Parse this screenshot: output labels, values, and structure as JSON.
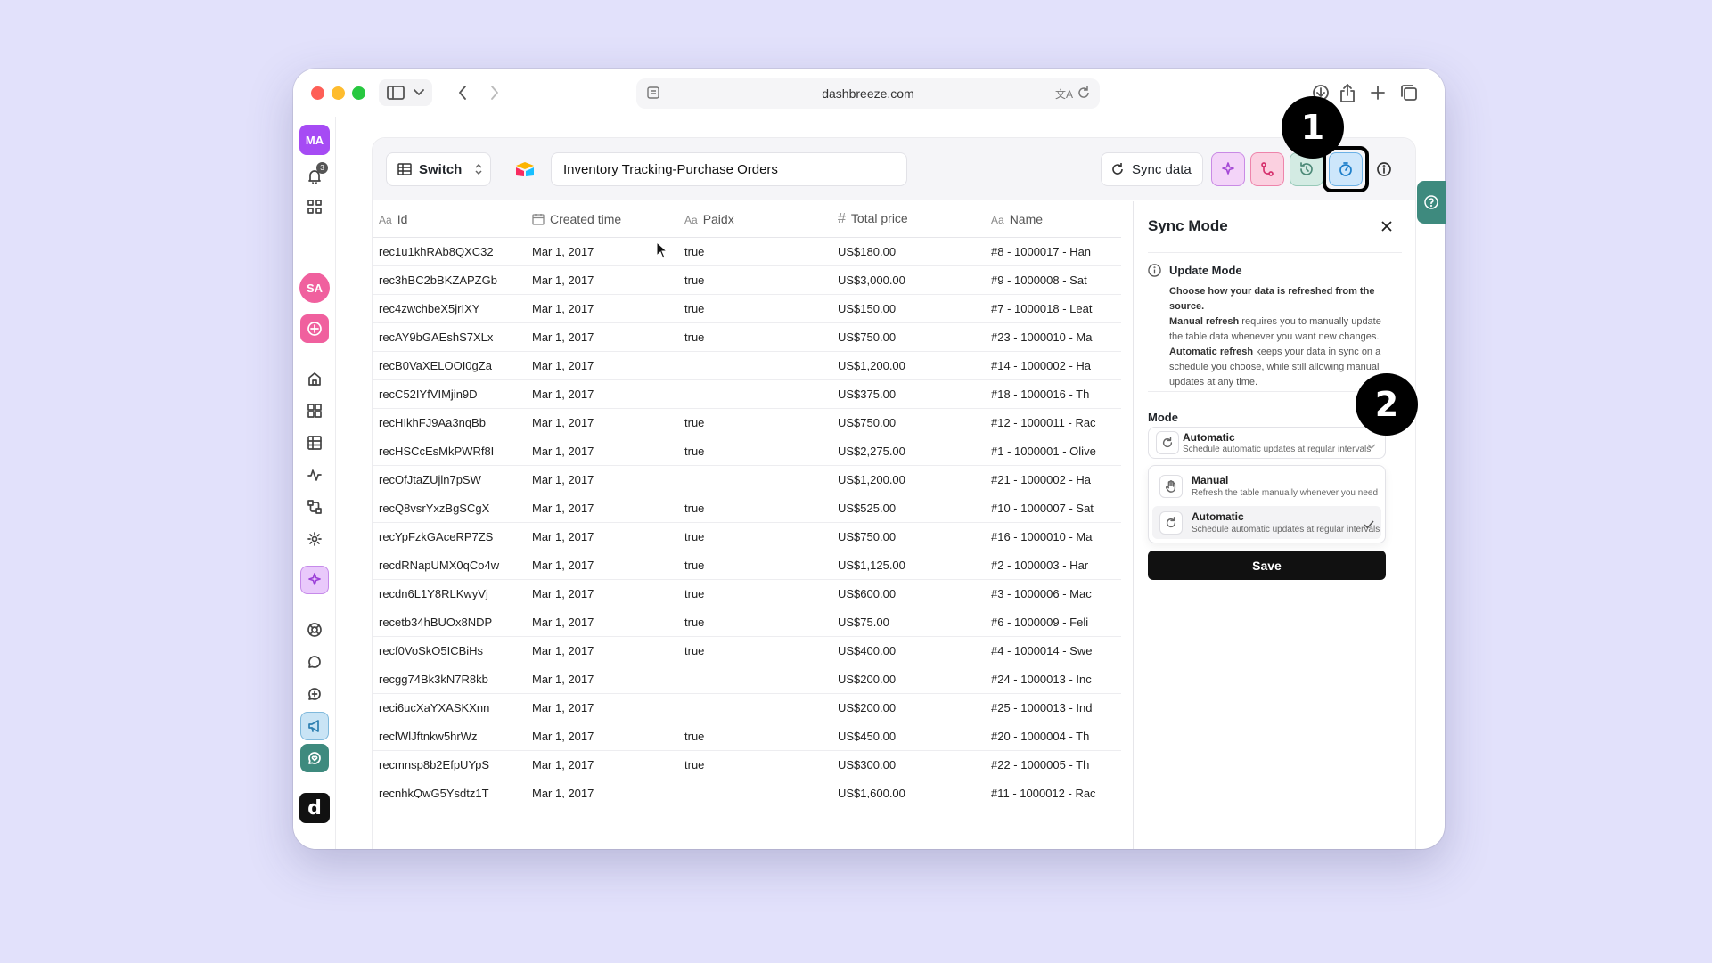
{
  "browser": {
    "url": "dashbreeze.com"
  },
  "sidebar": {
    "avatar_top": "MA",
    "notifications_count": "3",
    "avatar_second": "SA",
    "logo_letter": "d"
  },
  "header": {
    "switch_label": "Switch",
    "document_title": "Inventory Tracking-Purchase Orders",
    "sync_button_label": "Sync data"
  },
  "table": {
    "columns": [
      {
        "icon": "Aa",
        "label": "Id"
      },
      {
        "icon": "calendar",
        "label": "Created time"
      },
      {
        "icon": "Aa",
        "label": "Paidx"
      },
      {
        "icon": "#",
        "label": "Total price"
      },
      {
        "icon": "Aa",
        "label": "Name"
      }
    ],
    "rows": [
      [
        "rec1u1khRAb8QXC32",
        "Mar 1, 2017",
        "true",
        "US$180.00",
        "#8 - 1000017 - Han"
      ],
      [
        "rec3hBC2bBKZAPZGb",
        "Mar 1, 2017",
        "true",
        "US$3,000.00",
        "#9 - 1000008 - Sat"
      ],
      [
        "rec4zwchbeX5jrIXY",
        "Mar 1, 2017",
        "true",
        "US$150.00",
        "#7 - 1000018 - Leat"
      ],
      [
        "recAY9bGAEshS7XLx",
        "Mar 1, 2017",
        "true",
        "US$750.00",
        "#23 - 1000010 - Ma"
      ],
      [
        "recB0VaXELOOI0gZa",
        "Mar 1, 2017",
        "",
        "US$1,200.00",
        "#14 - 1000002 - Ha"
      ],
      [
        "recC52IYfVIMjin9D",
        "Mar 1, 2017",
        "",
        "US$375.00",
        "#18 - 1000016 - Th"
      ],
      [
        "recHIkhFJ9Aa3nqBb",
        "Mar 1, 2017",
        "true",
        "US$750.00",
        "#12 - 1000011 - Rac"
      ],
      [
        "recHSCcEsMkPWRf8I",
        "Mar 1, 2017",
        "true",
        "US$2,275.00",
        "#1 - 1000001 - Olive"
      ],
      [
        "recOfJtaZUjln7pSW",
        "Mar 1, 2017",
        "",
        "US$1,200.00",
        "#21 - 1000002 - Ha"
      ],
      [
        "recQ8vsrYxzBgSCgX",
        "Mar 1, 2017",
        "true",
        "US$525.00",
        "#10 - 1000007 - Sat"
      ],
      [
        "recYpFzkGAceRP7ZS",
        "Mar 1, 2017",
        "true",
        "US$750.00",
        "#16 - 1000010 - Ma"
      ],
      [
        "recdRNapUMX0qCo4w",
        "Mar 1, 2017",
        "true",
        "US$1,125.00",
        "#2 - 1000003 - Har"
      ],
      [
        "recdn6L1Y8RLKwyVj",
        "Mar 1, 2017",
        "true",
        "US$600.00",
        "#3 - 1000006 - Mac"
      ],
      [
        "recetb34hBUOx8NDP",
        "Mar 1, 2017",
        "true",
        "US$75.00",
        "#6 - 1000009 - Feli"
      ],
      [
        "recf0VoSkO5ICBiHs",
        "Mar 1, 2017",
        "true",
        "US$400.00",
        "#4 - 1000014 - Swe"
      ],
      [
        "recgg74Bk3kN7R8kb",
        "Mar 1, 2017",
        "",
        "US$200.00",
        "#24 - 1000013 - Inc"
      ],
      [
        "reci6ucXaYXASKXnn",
        "Mar 1, 2017",
        "",
        "US$200.00",
        "#25 - 1000013 - Ind"
      ],
      [
        "reclWlJftnkw5hrWz",
        "Mar 1, 2017",
        "true",
        "US$450.00",
        "#20 - 1000004 - Th"
      ],
      [
        "recmnsp8b2EfpUYpS",
        "Mar 1, 2017",
        "true",
        "US$300.00",
        "#22 - 1000005 - Th"
      ],
      [
        "recnhkQwG5Ysdtz1T",
        "Mar 1, 2017",
        "",
        "US$1,600.00",
        "#11 - 1000012 - Rac"
      ]
    ]
  },
  "sync_panel": {
    "title": "Sync Mode",
    "info_title": "Update Mode",
    "info_lead": "Choose how your data is refreshed from the source.",
    "manual_bold": "Manual refresh",
    "manual_text": " requires you to manually update the table data whenever you want new changes.",
    "auto_bold": "Automatic refresh",
    "auto_text": " keeps your data in sync on a schedule you choose, while still allowing manual updates at any time.",
    "mode_label": "Mode",
    "selected": {
      "title": "Automatic",
      "subtitle": "Schedule automatic updates at regular intervals"
    },
    "options": [
      {
        "title": "Manual",
        "subtitle": "Refresh the table manually whenever you need",
        "icon": "hand-icon"
      },
      {
        "title": "Automatic",
        "subtitle": "Schedule automatic updates at regular intervals",
        "icon": "refresh-icon",
        "checked": true
      }
    ],
    "save_label": "Save"
  },
  "callouts": {
    "first": "1",
    "second": "2"
  },
  "colors": {
    "background": "#e2e1fb",
    "sync_active": "#cde6fb",
    "ai_button": "#f3d4f8",
    "branch_button": "#fbd0e0",
    "history_button": "#d3ebe3",
    "help_tab": "#3e8a7e"
  }
}
